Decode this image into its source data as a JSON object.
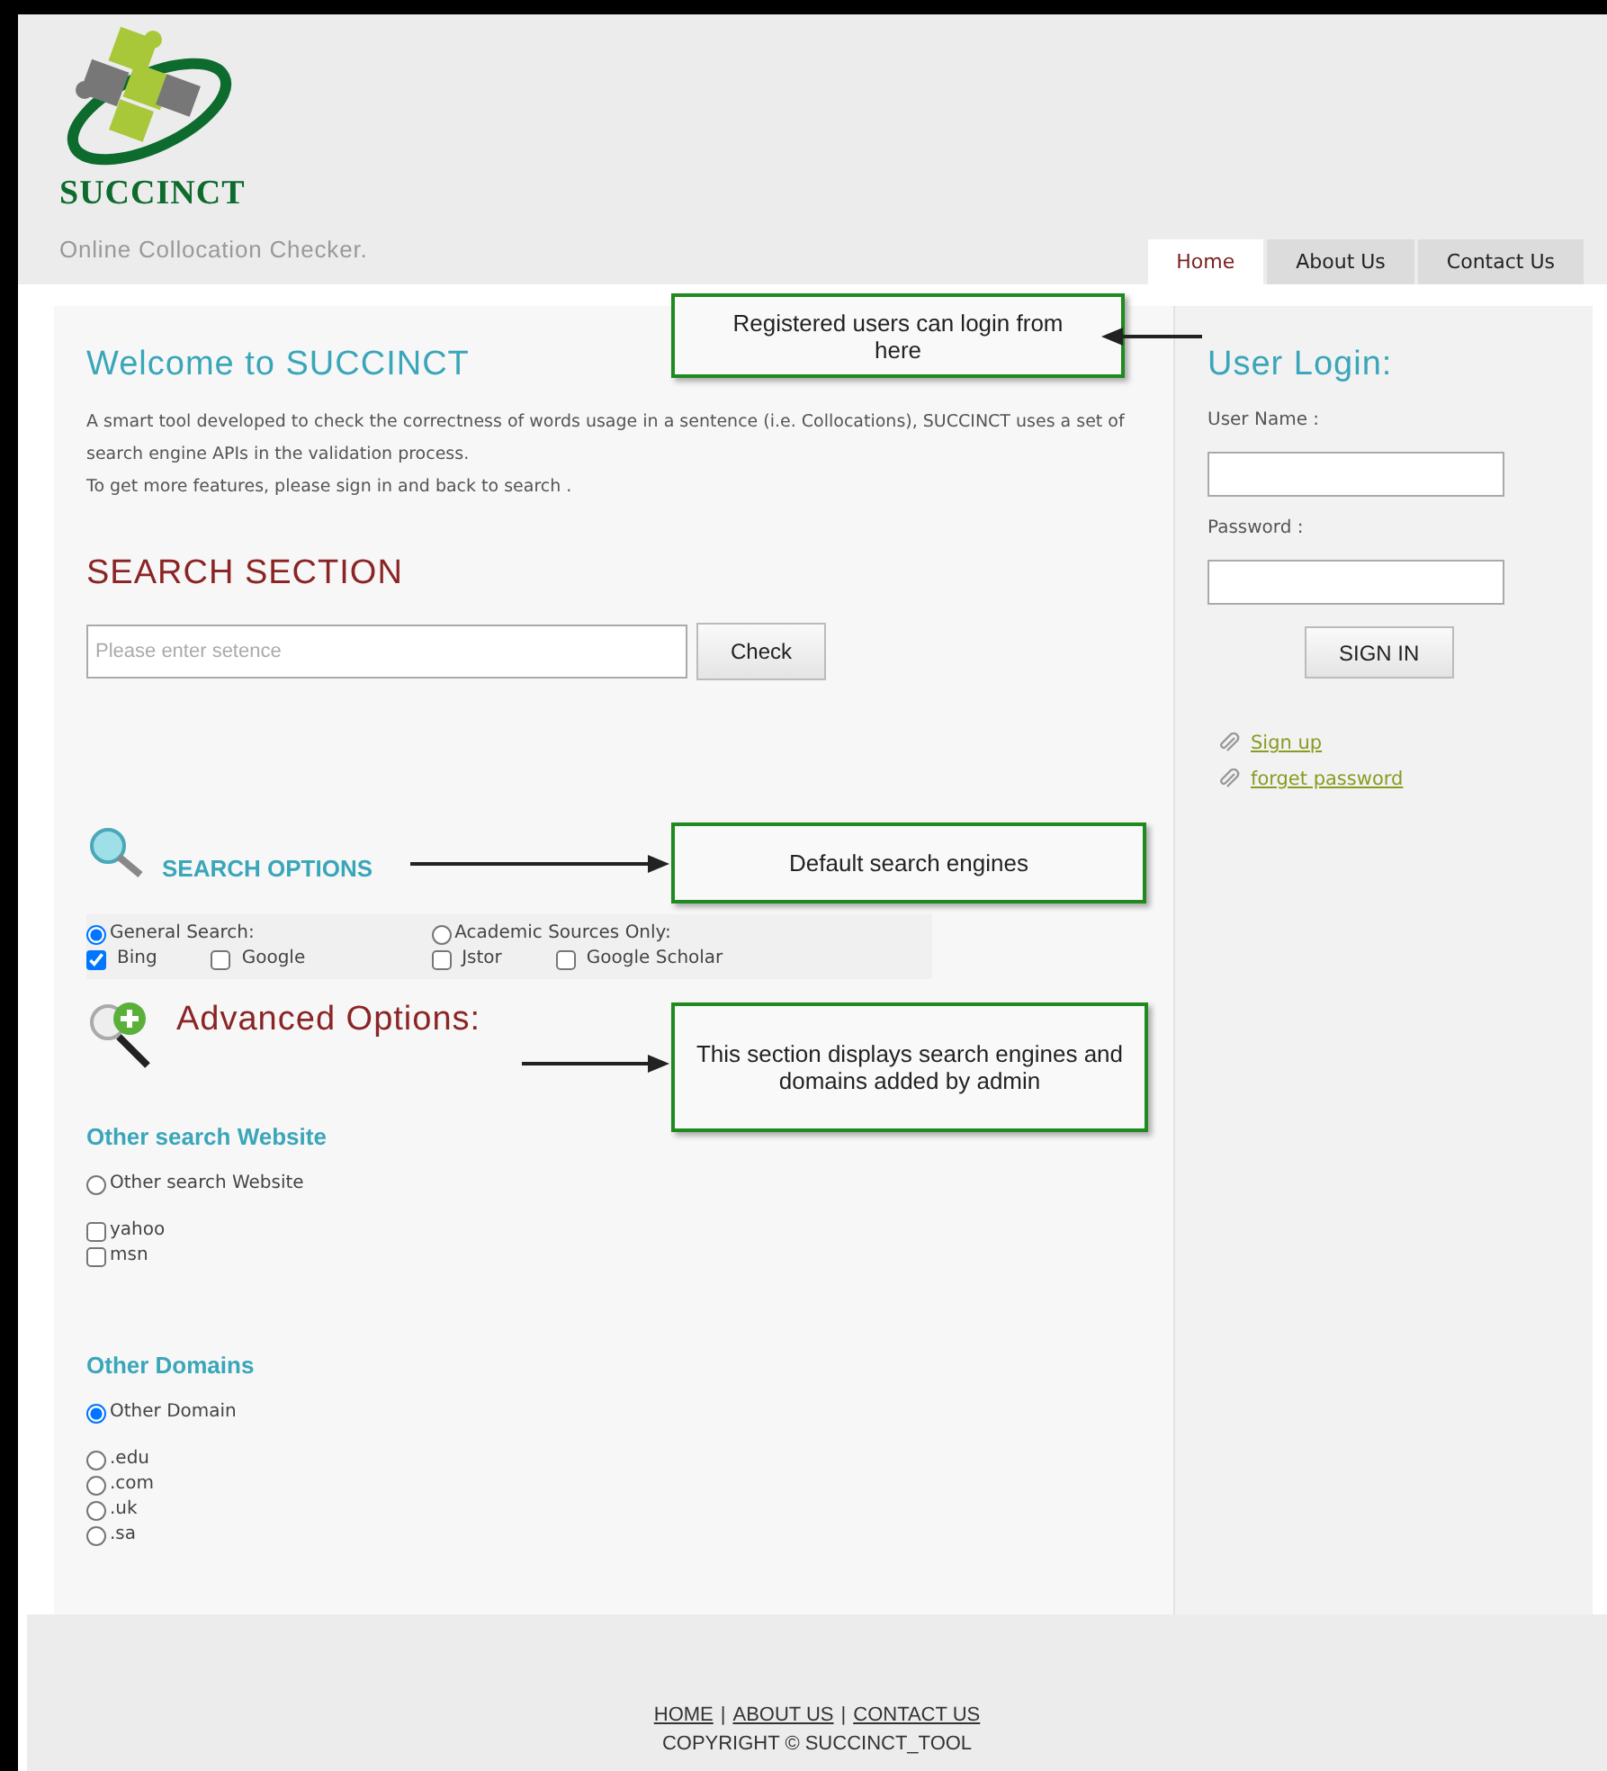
{
  "header": {
    "logo_text": "SUCCINCT",
    "tagline": "Online Collocation Checker."
  },
  "tabs": [
    {
      "label": "Home",
      "selected": true
    },
    {
      "label": "About Us",
      "selected": false
    },
    {
      "label": "Contact Us",
      "selected": false
    }
  ],
  "welcome": {
    "title": "Welcome to SUCCINCT",
    "paragraphs": [
      "A smart tool developed to check the correctness of words usage in a sentence (i.e. Collocations), SUCCINCT uses a set of search engine APIs in the validation process.",
      "To get more features, please sign in and back to search ."
    ]
  },
  "search_section": {
    "title": "SEARCH SECTION",
    "placeholder": "Please enter setence",
    "button": "Check"
  },
  "search_options": {
    "title": "SEARCH OPTIONS",
    "groups": [
      {
        "label": "General Search:",
        "selected": true,
        "engines": [
          {
            "label": "Bing",
            "checked": true
          },
          {
            "label": "Google",
            "checked": false
          }
        ]
      },
      {
        "label": "Academic Sources Only:",
        "selected": false,
        "engines": [
          {
            "label": "Jstor",
            "checked": false
          },
          {
            "label": "Google Scholar",
            "checked": false
          }
        ]
      }
    ]
  },
  "advanced_options": {
    "title": "Advanced Options:"
  },
  "other_search_website": {
    "heading": "Other search Website",
    "radio": {
      "label": "Other search Website",
      "selected": false
    },
    "sites": [
      {
        "label": "yahoo",
        "checked": false
      },
      {
        "label": "msn",
        "checked": false
      }
    ]
  },
  "other_domains": {
    "heading": "Other Domains",
    "radio": {
      "label": "Other Domain",
      "selected": true
    },
    "domains": [
      {
        "label": ".edu",
        "selected": false
      },
      {
        "label": ".com",
        "selected": false
      },
      {
        "label": ".uk",
        "selected": false
      },
      {
        "label": ".sa",
        "selected": false
      }
    ]
  },
  "login": {
    "title": "User Login:",
    "username_label": "User Name :",
    "password_label": "Password :",
    "button": "SIGN IN",
    "links": [
      "Sign up",
      "forget password"
    ]
  },
  "annotations": [
    {
      "text": "Registered users can login from here"
    },
    {
      "text": "Default search engines"
    },
    {
      "text": "This section displays search engines and domains added by admin"
    }
  ],
  "footer": {
    "links": [
      "HOME",
      "ABOUT US",
      "CONTACT US"
    ],
    "separators": [
      "|",
      "|"
    ],
    "copyright": "COPYRIGHT © SUCCINCT_TOOL"
  }
}
